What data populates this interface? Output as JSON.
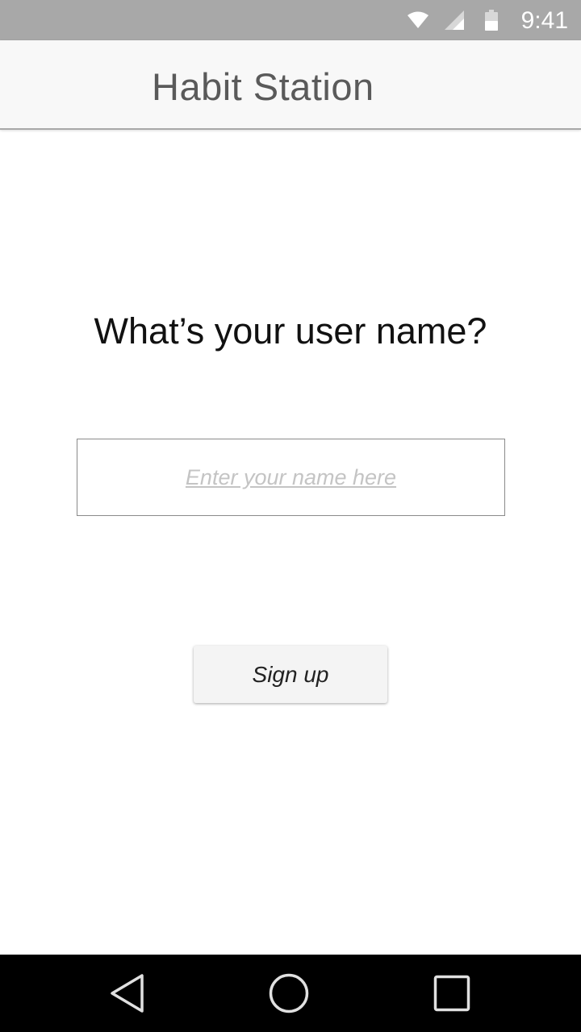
{
  "status_bar": {
    "time": "9:41",
    "icons": [
      "wifi-icon",
      "signal-icon",
      "battery-icon"
    ]
  },
  "app_bar": {
    "title": "Habit Station"
  },
  "main": {
    "question": "What’s your user name?",
    "name_input": {
      "placeholder": "Enter your name here",
      "value": ""
    },
    "signup_label": "Sign up"
  },
  "nav_bar": {
    "icons": [
      "back-icon",
      "home-icon",
      "recents-icon"
    ]
  },
  "colors": {
    "status_bar_bg": "#a8a8a8",
    "app_bar_bg": "#f8f8f8",
    "title_text": "#5a5a5a",
    "placeholder_text": "#c4c4c4",
    "button_bg": "#f4f4f4",
    "nav_bar_bg": "#000000"
  }
}
